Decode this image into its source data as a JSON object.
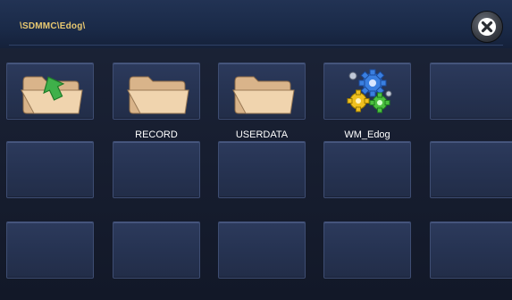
{
  "header": {
    "path": "\\SDMMC\\Edog\\",
    "close_icon": "close-icon"
  },
  "grid": {
    "rows": 3,
    "columns": 5,
    "items": [
      {
        "label": "",
        "icon": "folder-up-icon"
      },
      {
        "label": "RECORD",
        "icon": "folder-icon"
      },
      {
        "label": "USERDATA",
        "icon": "folder-icon"
      },
      {
        "label": "WM_Edog",
        "icon": "gears-app-icon"
      }
    ]
  },
  "colors": {
    "path_text": "#e8c870",
    "tile": "#263352",
    "background": "#141a2a"
  }
}
